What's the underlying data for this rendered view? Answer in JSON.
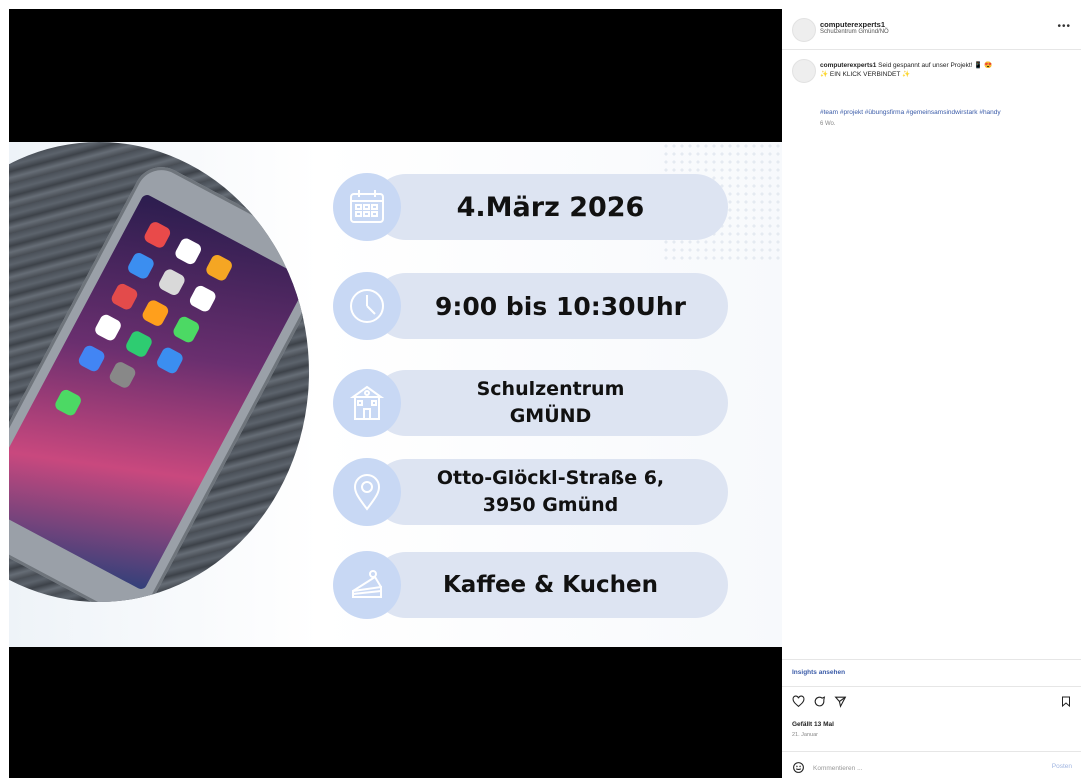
{
  "post": {
    "account": "computerexperts1",
    "location": "Schulzentrum Gmünd/NÖ",
    "caption_user": "computerexperts1",
    "caption_text": "Seid gespannt auf unser Projekt! 📱 😍",
    "caption_line2": "✨ EIN KLICK VERBINDET ✨",
    "hashtags": "#team #projekt #übungsfirma #gemeinsamsindwirstark #handy",
    "age": "6 Wo.",
    "more_icon": "•••"
  },
  "slide": {
    "date": "4.März 2026",
    "time": "9:00 bis 10:30Uhr",
    "venue_line1": "Schulzentrum",
    "venue_line2": "GMÜND",
    "address_line1": "Otto-Glöckl-Straße 6,",
    "address_line2": "3950 Gmünd",
    "extra": "Kaffee & Kuchen"
  },
  "footer": {
    "insights": "Insights ansehen",
    "likes": "Gefällt 13 Mal",
    "date": "21. Januar",
    "comment_placeholder": "Kommentieren ...",
    "post_button": "Posten"
  },
  "icons": {
    "calendar": "calendar-icon",
    "clock": "clock-icon",
    "school": "school-icon",
    "location": "location-pin-icon",
    "cake": "cake-icon",
    "heart": "heart-icon",
    "comment": "comment-icon",
    "share": "share-icon",
    "bookmark": "bookmark-icon",
    "emoji": "emoji-icon"
  },
  "colors": {
    "pill": "#dde4f2",
    "icon_circle": "#c8d8f4",
    "link": "#3a5ba8"
  }
}
